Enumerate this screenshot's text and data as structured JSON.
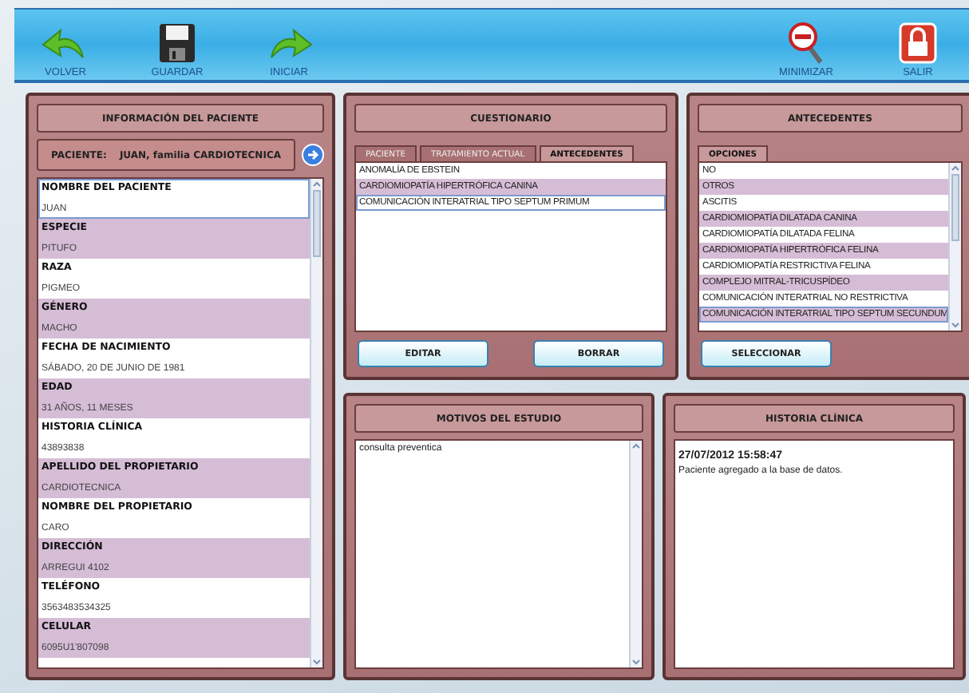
{
  "toolbar": {
    "left_buttons": [
      {
        "label": "VOLVER",
        "kind": "back"
      },
      {
        "label": "GUARDAR",
        "kind": "save"
      },
      {
        "label": "INICIAR",
        "kind": "forward"
      }
    ],
    "right_buttons": [
      {
        "label": "MINIMIZAR",
        "kind": "minimize"
      },
      {
        "label": "SALIR",
        "kind": "exit"
      }
    ]
  },
  "patient_panel": {
    "title": "INFORMACIÓN DEL PACIENTE",
    "patient_label": "PACIENTE:",
    "patient_name": "JUAN, familia CARDIOTECNICA",
    "fields": [
      {
        "label": "NOMBRE DEL PACIENTE",
        "value": "JUAN",
        "focused": true
      },
      {
        "label": "ESPECIE",
        "value": "PITUFO",
        "focused": false
      },
      {
        "label": "RAZA",
        "value": "PIGMEO",
        "focused": false
      },
      {
        "label": "GÉNERO",
        "value": "MACHO",
        "focused": false
      },
      {
        "label": "FECHA DE NACIMIENTO",
        "value": "SÁBADO, 20 DE JUNIO DE 1981",
        "focused": false
      },
      {
        "label": "EDAD",
        "value": "31 AÑOS, 11 MESES",
        "focused": false
      },
      {
        "label": "HISTORIA CLÍNICA",
        "value": "43893838",
        "focused": false
      },
      {
        "label": "APELLIDO DEL PROPIETARIO",
        "value": "CARDIOTECNICA",
        "focused": false
      },
      {
        "label": "NOMBRE DEL PROPIETARIO",
        "value": "CARO",
        "focused": false
      },
      {
        "label": "DIRECCIÓN",
        "value": "ARREGUI 4102",
        "focused": false
      },
      {
        "label": "TELÉFONO",
        "value": "3563483534325",
        "focused": false
      },
      {
        "label": "CELULAR",
        "value": "6095U1'807098",
        "focused": false
      }
    ]
  },
  "questionnaire": {
    "title": "CUESTIONARIO",
    "tabs": [
      {
        "label": "PACIENTE",
        "selected": false
      },
      {
        "label": "TRATAMIENTO ACTUAL",
        "selected": false
      },
      {
        "label": "ANTECEDENTES",
        "selected": true
      }
    ],
    "items": [
      {
        "text": "ANOMALÍA DE EBSTEIN",
        "focused": false
      },
      {
        "text": "CARDIOMIOPATÍA HIPERTRÓFICA CANINA",
        "focused": false
      },
      {
        "text": "COMUNICACIÓN INTERATRIAL TIPO SEPTUM PRIMUM",
        "focused": true
      }
    ],
    "buttons": [
      "EDITAR",
      "BORRAR"
    ]
  },
  "history_options": {
    "title": "ANTECEDENTES",
    "tabs": [
      {
        "label": "OPCIONES",
        "selected": true
      }
    ],
    "items": [
      {
        "text": "NO",
        "focused": false
      },
      {
        "text": "OTROS",
        "focused": false
      },
      {
        "text": "ASCITIS",
        "focused": false
      },
      {
        "text": "CARDIOMIOPATÍA DILATADA CANINA",
        "focused": false
      },
      {
        "text": "CARDIOMIOPATÍA DILATADA FELINA",
        "focused": false
      },
      {
        "text": "CARDIOMIOPATÍA HIPERTRÓFICA FELINA",
        "focused": false
      },
      {
        "text": "CARDIOMIOPATÍA RESTRICTIVA FELINA",
        "focused": false
      },
      {
        "text": "COMPLEJO MITRAL-TRICUSPÍDEO",
        "focused": false
      },
      {
        "text": "COMUNICACIÓN INTERATRIAL NO RESTRICTIVA",
        "focused": false
      },
      {
        "text": "COMUNICACIÓN INTERATRIAL TIPO SEPTUM SECUNDUM",
        "focused": true
      }
    ],
    "button": "SELECCIONAR"
  },
  "study_reasons": {
    "title": "MOTIVOS DEL ESTUDIO",
    "text": "consulta preventica"
  },
  "clinical_history": {
    "title": "HISTORIA CLÍNICA",
    "entries": [
      {
        "timestamp": "27/07/2012 15:58:47",
        "note": "Paciente agregado a la base de datos."
      }
    ]
  }
}
